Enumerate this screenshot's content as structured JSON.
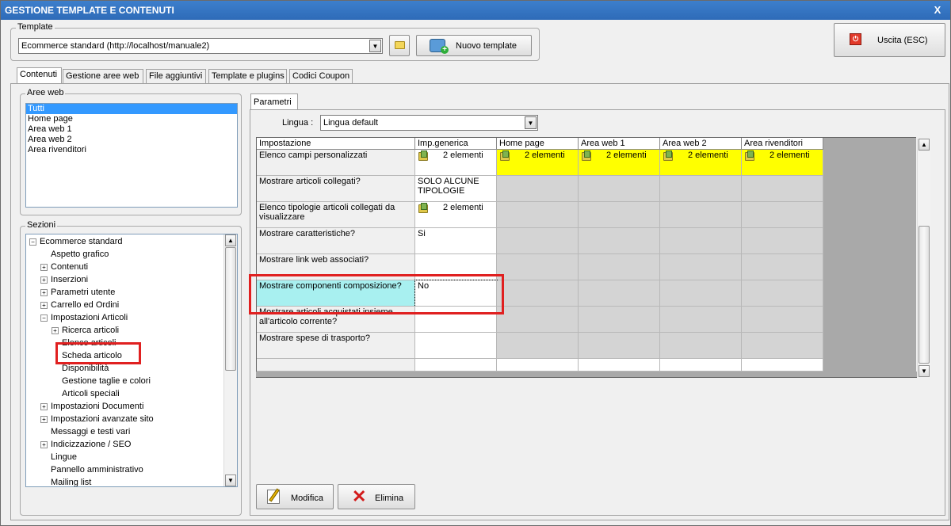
{
  "window": {
    "title": "GESTIONE TEMPLATE E CONTENUTI",
    "close_glyph": "X"
  },
  "template_group": {
    "label": "Template",
    "selected": "Ecommerce standard (http://localhost/manuale2)",
    "new_button": "Nuovo template"
  },
  "exit_button": "Uscita (ESC)",
  "tabs": [
    "Contenuti",
    "Gestione aree web",
    "File aggiuntivi",
    "Template e plugins",
    "Codici Coupon"
  ],
  "aree_web": {
    "label": "Aree web",
    "items": [
      "Tutti",
      "Home page",
      "Area web 1",
      "Area web 2",
      "Area rivenditori"
    ],
    "selected_index": 0
  },
  "sezioni": {
    "label": "Sezioni",
    "items": [
      {
        "text": "Ecommerce standard",
        "level": 0,
        "toggle": "−"
      },
      {
        "text": "Aspetto grafico",
        "level": 1,
        "toggle": ""
      },
      {
        "text": "Contenuti",
        "level": 1,
        "toggle": "+"
      },
      {
        "text": "Inserzioni",
        "level": 1,
        "toggle": "+"
      },
      {
        "text": "Parametri utente",
        "level": 1,
        "toggle": "+"
      },
      {
        "text": "Carrello ed Ordini",
        "level": 1,
        "toggle": "+"
      },
      {
        "text": "Impostazioni Articoli",
        "level": 1,
        "toggle": "−"
      },
      {
        "text": "Ricerca articoli",
        "level": 2,
        "toggle": "+"
      },
      {
        "text": "Elenco articoli",
        "level": 2,
        "toggle": ""
      },
      {
        "text": "Scheda articolo",
        "level": 2,
        "toggle": ""
      },
      {
        "text": "Disponibilità",
        "level": 2,
        "toggle": ""
      },
      {
        "text": "Gestione taglie e colori",
        "level": 2,
        "toggle": ""
      },
      {
        "text": "Articoli speciali",
        "level": 2,
        "toggle": ""
      },
      {
        "text": "Impostazioni Documenti",
        "level": 1,
        "toggle": "+"
      },
      {
        "text": "Impostazioni avanzate sito",
        "level": 1,
        "toggle": "+"
      },
      {
        "text": "Messaggi e testi vari",
        "level": 1,
        "toggle": ""
      },
      {
        "text": "Indicizzazione / SEO",
        "level": 1,
        "toggle": "+"
      },
      {
        "text": "Lingue",
        "level": 1,
        "toggle": ""
      },
      {
        "text": "Pannello amministrativo",
        "level": 1,
        "toggle": ""
      },
      {
        "text": "Mailing list",
        "level": 1,
        "toggle": ""
      }
    ]
  },
  "parametri": {
    "tab": "Parametri",
    "lingua_label": "Lingua :",
    "lingua_value": "Lingua default",
    "columns": [
      "Impostazione",
      "Imp.generica",
      "Home page",
      "Area web 1",
      "Area web 2",
      "Area rivenditori"
    ],
    "rows": [
      {
        "name": "Elenco campi personalizzati",
        "generic": "2 elementi",
        "generic_icon": true,
        "areas": [
          "2 elementi",
          "2 elementi",
          "2 elementi",
          "2 elementi"
        ],
        "highlight": true
      },
      {
        "name": "Mostrare articoli collegati?",
        "generic": "SOLO ALCUNE TIPOLOGIE",
        "generic_icon": false,
        "areas": [
          "",
          "",
          "",
          ""
        ],
        "highlight": false
      },
      {
        "name": "Elenco tipologie articoli collegati da visualizzare",
        "generic": "2 elementi",
        "generic_icon": true,
        "areas": [
          "",
          "",
          "",
          ""
        ],
        "highlight": false
      },
      {
        "name": "Mostrare caratteristiche?",
        "generic": "Si",
        "generic_icon": false,
        "areas": [
          "",
          "",
          "",
          ""
        ],
        "highlight": false
      },
      {
        "name": "Mostrare link web associati?",
        "generic": "",
        "generic_icon": false,
        "areas": [
          "",
          "",
          "",
          ""
        ],
        "highlight": false
      },
      {
        "name": "Mostrare componenti composizione?",
        "generic": "No",
        "generic_icon": false,
        "areas": [
          "",
          "",
          "",
          ""
        ],
        "highlight": false
      },
      {
        "name": "Mostrare articoli acquistati insieme all'articolo corrente?",
        "generic": "",
        "generic_icon": false,
        "areas": [
          "",
          "",
          "",
          ""
        ],
        "highlight": false
      },
      {
        "name": "Mostrare spese di trasporto?",
        "generic": "",
        "generic_icon": false,
        "areas": [
          "",
          "",
          "",
          ""
        ],
        "highlight": false
      }
    ],
    "modify_button": "Modifica",
    "delete_button": "Elimina"
  },
  "colors": {
    "highlight": "#ffff00",
    "selected_row": "#a8f0f0",
    "annotation": "#e02020"
  }
}
